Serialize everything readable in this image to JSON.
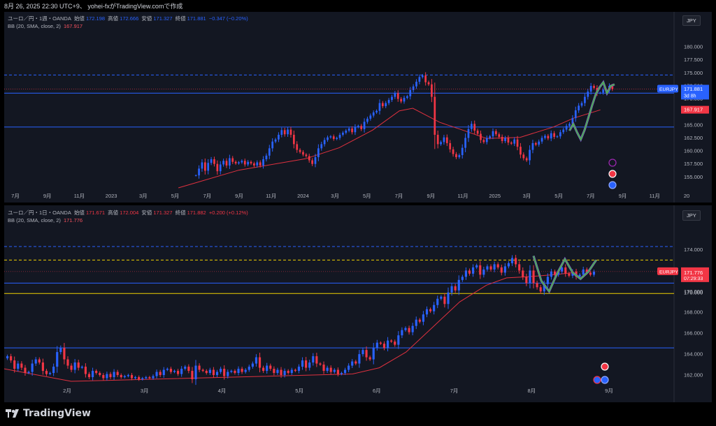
{
  "header": {
    "caption": "8月 26, 2025 22:30 UTC+9、 yohei-fxがTradingView.comで作成"
  },
  "footer": {
    "brand": "TradingView"
  },
  "chart_data": [
    {
      "type": "candlestick",
      "pane": "weekly",
      "symbol_line": "ユーロ／円・1週・OANDA",
      "ohlc": {
        "open_label": "始値",
        "open": "172.198",
        "high_label": "高値",
        "high": "172.666",
        "low_label": "安値",
        "low": "171.327",
        "close_label": "終値",
        "close": "171.881",
        "change": "−0.347 (−0.20%)"
      },
      "indicator": {
        "label": "BB (20, SMA, close, 2)",
        "value": "167.917"
      },
      "currency": "JPY",
      "ylim": [
        152.9,
        182.7
      ],
      "yticks": [
        "180.000",
        "177.500",
        "175.000",
        "172.500",
        "170.000",
        "167.500",
        "165.000",
        "162.500",
        "160.000",
        "157.500",
        "155.000"
      ],
      "ytick_values": [
        180,
        177.5,
        175,
        172.5,
        170,
        167.5,
        165,
        162.5,
        160,
        157.5,
        155
      ],
      "xticks": [
        "7月",
        "9月",
        "11月",
        "2023",
        "3月",
        "5月",
        "7月",
        "9月",
        "11月",
        "2024",
        "3月",
        "5月",
        "7月",
        "9月",
        "11月",
        "2025",
        "3月",
        "5月",
        "7月",
        "9月",
        "11月",
        "20"
      ],
      "horizontal_lines": {
        "solid": [
          171.1,
          164.6
        ],
        "dashed": [
          174.6
        ]
      },
      "price_labels": {
        "symbol": "EURJPY",
        "last": "171.881",
        "countdown": "3d 8h",
        "bb": "167.917"
      },
      "start_price": 155.3,
      "closes": [
        155.3,
        156.6,
        157.8,
        156.2,
        157.7,
        158.4,
        157.5,
        156.1,
        157.4,
        158.1,
        157.2,
        158.6,
        157.9,
        157.6,
        157.8,
        158.1,
        157.4,
        157.9,
        157.6,
        157.2,
        157.8,
        157.2,
        158.4,
        159.1,
        160.5,
        161.8,
        162.2,
        163.1,
        164.0,
        163.2,
        164.1,
        163.1,
        161.3,
        160.2,
        159.8,
        159.3,
        159.0,
        158.2,
        157.5,
        158.8,
        160.5,
        161.3,
        162.1,
        162.6,
        162.8,
        162.3,
        162.5,
        163.1,
        163.5,
        163.9,
        164.3,
        163.6,
        164.6,
        164.8,
        164.2,
        165.6,
        166.2,
        166.8,
        167.4,
        167.7,
        169.2,
        168.6,
        169.2,
        169.8,
        170.4,
        171.1,
        170.0,
        169.5,
        170.2,
        170.5,
        171.7,
        172.4,
        173.3,
        174.2,
        174.5,
        173.2,
        172.8,
        170.4,
        163.1,
        161.3,
        161.7,
        162.6,
        161.5,
        160.3,
        159.4,
        158.8,
        159.2,
        160.6,
        162.5,
        164.2,
        165.2,
        163.9,
        163.3,
        162.1,
        161.7,
        162.5,
        162.8,
        163.8,
        163.2,
        162.7,
        161.9,
        162.5,
        161.6,
        161.4,
        162.2,
        160.8,
        159.3,
        158.6,
        158.2,
        160.2,
        161.5,
        161.2,
        161.8,
        162.5,
        162.9,
        162.4,
        163.4,
        162.7,
        162.8,
        163.6,
        164.1,
        164.8,
        165.2,
        166.3,
        167.8,
        168.7,
        169.2,
        170.4,
        171.4,
        172.5,
        172.1,
        171.1,
        171.2,
        171.8,
        171.6,
        172.5,
        171.9
      ],
      "bb_basis": [
        {
          "x": 0.26,
          "p": 152.9
        },
        {
          "x": 0.35,
          "p": 156.3
        },
        {
          "x": 0.45,
          "p": 158.5
        },
        {
          "x": 0.5,
          "p": 160.6
        },
        {
          "x": 0.55,
          "p": 164.0
        },
        {
          "x": 0.59,
          "p": 167.7
        },
        {
          "x": 0.61,
          "p": 168.2
        },
        {
          "x": 0.65,
          "p": 165.5
        },
        {
          "x": 0.68,
          "p": 164.2
        },
        {
          "x": 0.72,
          "p": 162.4
        },
        {
          "x": 0.77,
          "p": 162.6
        },
        {
          "x": 0.82,
          "p": 164.6
        },
        {
          "x": 0.85,
          "p": 166.3
        },
        {
          "x": 0.89,
          "p": 167.9
        }
      ],
      "zigzag_start_index": 122,
      "zigzag": [
        163.9,
        165.2,
        163.6,
        162.2,
        164.0,
        166.3,
        168.7,
        170.9,
        172.2,
        173.2,
        171.1,
        172.5,
        172.8
      ]
    },
    {
      "type": "candlestick",
      "pane": "daily",
      "symbol_line": "ユーロ／円・1日・OANDA",
      "ohlc": {
        "open_label": "始値",
        "open": "171.671",
        "high_label": "高値",
        "high": "172.004",
        "low_label": "安値",
        "low": "171.327",
        "close_label": "終値",
        "close": "171.882",
        "change": "+0.200 (+0.12%)"
      },
      "indicator": {
        "label": "BB (20, SMA, close, 2)",
        "value": "171.776"
      },
      "currency": "JPY",
      "ylim": [
        161.0,
        175.7
      ],
      "yticks": [
        "174.000",
        "172.000",
        "170.000",
        "168.000",
        "166.000",
        "164.000",
        "162.000"
      ],
      "ytick_values": [
        174,
        172,
        170,
        168,
        166,
        164,
        162
      ],
      "xticks": [
        "2月",
        "3月",
        "4月",
        "5月",
        "6月",
        "7月",
        "8月",
        "9月"
      ],
      "horizontal_lines": {
        "solid": [
          170.8,
          164.6
        ],
        "dashed": [
          174.3
        ],
        "yellow_dashed": [
          173.0
        ],
        "yellow_solid": [
          169.8
        ]
      },
      "price_labels": {
        "symbol": "EURJPY",
        "last": "171.882",
        "countdown": "07:29:33",
        "bb": "171.776",
        "low_line": "170.000"
      },
      "start_price": 163.6,
      "closes": [
        163.8,
        163.4,
        162.6,
        163.1,
        162.7,
        162.2,
        162.3,
        163.1,
        163.5,
        163.2,
        162.4,
        162.1,
        162.2,
        162.8,
        164.2,
        164.6,
        163.5,
        162.9,
        162.5,
        163.2,
        162.7,
        162.8,
        162.1,
        161.8,
        162.4,
        162.2,
        162.0,
        161.7,
        162.1,
        161.8,
        162.3,
        162.0,
        161.8,
        161.9,
        162.0,
        161.7,
        161.8,
        161.6,
        161.7,
        161.8,
        161.7,
        161.9,
        162.3,
        162.0,
        162.5,
        162.6,
        162.3,
        162.4,
        162.1,
        162.6,
        162.8,
        162.4,
        161.6,
        162.9,
        162.5,
        162.4,
        162.2,
        162.5,
        162.0,
        162.3,
        162.6,
        161.9,
        162.3,
        162.4,
        162.2,
        162.6,
        162.3,
        162.5,
        162.8,
        163.1,
        163.7,
        162.7,
        162.4,
        162.9,
        162.6,
        162.2,
        162.5,
        162.0,
        162.4,
        162.2,
        162.5,
        162.4,
        162.8,
        163.4,
        162.7,
        163.2,
        163.8,
        163.1,
        163.0,
        162.4,
        162.7,
        162.3,
        162.5,
        162.1,
        162.2,
        162.5,
        162.9,
        163.3,
        163.1,
        164.0,
        164.4,
        163.7,
        163.5,
        164.6,
        165.1,
        165.0,
        164.6,
        165.3,
        165.2,
        164.9,
        165.8,
        166.3,
        166.5,
        166.1,
        166.7,
        167.3,
        167.1,
        167.8,
        168.3,
        168.1,
        168.7,
        169.3,
        169.5,
        168.8,
        169.9,
        170.5,
        170.1,
        171.1,
        171.4,
        172.0,
        171.7,
        172.3,
        172.5,
        171.6,
        172.1,
        172.4,
        172.1,
        172.6,
        172.3,
        171.8,
        172.4,
        172.7,
        173.2,
        172.6,
        172.0,
        171.4,
        170.8,
        172.0,
        170.8,
        170.4,
        170.0,
        170.7,
        171.4,
        171.9,
        171.6,
        171.9,
        172.3,
        171.7,
        171.5,
        171.9,
        171.4,
        171.6,
        172.1,
        171.8,
        171.6,
        171.9
      ],
      "bb_basis": [
        {
          "x": 0.0,
          "p": 162.6
        },
        {
          "x": 0.1,
          "p": 161.4
        },
        {
          "x": 0.52,
          "p": 162.1
        },
        {
          "x": 0.56,
          "p": 162.7
        },
        {
          "x": 0.6,
          "p": 164.2
        },
        {
          "x": 0.64,
          "p": 166.6
        },
        {
          "x": 0.68,
          "p": 169.0
        },
        {
          "x": 0.72,
          "p": 170.6
        },
        {
          "x": 0.75,
          "p": 171.3
        },
        {
          "x": 0.78,
          "p": 171.4
        },
        {
          "x": 0.82,
          "p": 171.6
        },
        {
          "x": 0.85,
          "p": 171.8
        }
      ],
      "zigzag_start_index": 148,
      "zigzag": [
        173.4,
        171.0,
        170.0,
        171.7,
        173.1,
        171.8,
        171.2,
        171.9,
        173.0
      ]
    }
  ]
}
